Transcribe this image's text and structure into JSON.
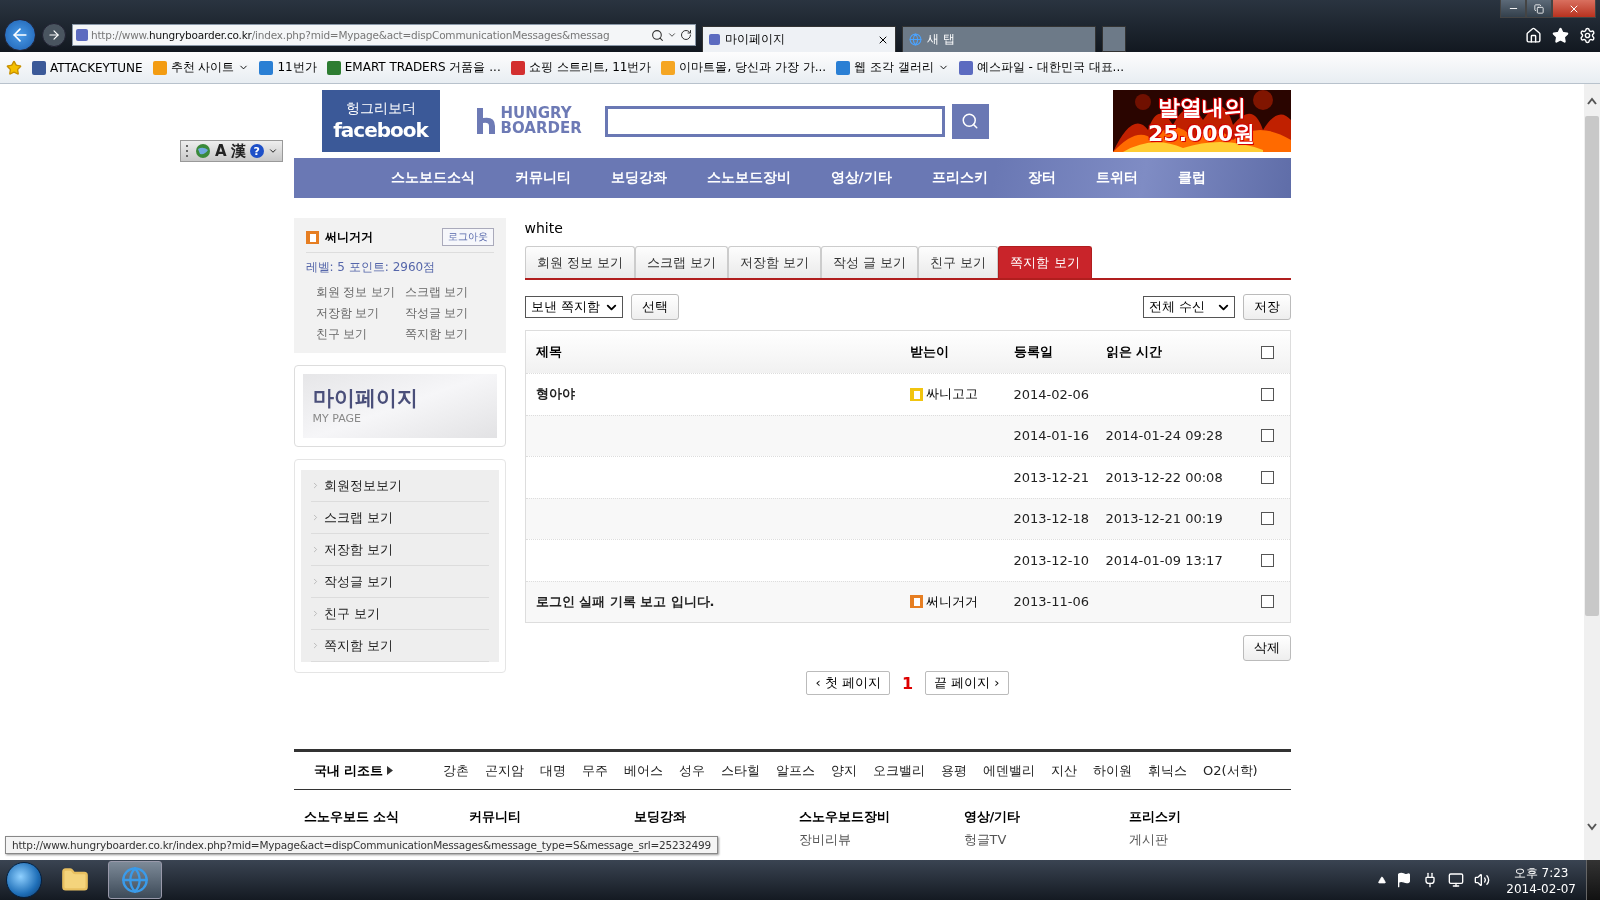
{
  "browser": {
    "address": "http://www.**hungryboarder.co.kr**/index.php?mid=Mypage&act=dispCommunicationMessages&messag",
    "tabs": [
      {
        "title": "마이페이지",
        "selected": true
      },
      {
        "title": "새 탭",
        "selected": false
      }
    ],
    "favorites": [
      {
        "label": "ATTACKEYTUNE",
        "color": "#3b5998",
        "dropdown": false
      },
      {
        "label": "추천 사이트",
        "color": "#f39c12",
        "dropdown": true
      },
      {
        "label": "11번가",
        "color": "#2a7fd4",
        "dropdown": false
      },
      {
        "label": "EMART TRADERS 거품을 ...",
        "color": "#2e7d32",
        "dropdown": false
      },
      {
        "label": "쇼핑 스트리트, 11번가",
        "color": "#d32f2f",
        "dropdown": false
      },
      {
        "label": "이마트몰, 당신과 가장 가...",
        "color": "#f5a623",
        "dropdown": false
      },
      {
        "label": "웹 조각 갤러리",
        "color": "#2a7fd4",
        "dropdown": true
      },
      {
        "label": "예스파일 - 대한민국 대표...",
        "color": "#5c6bc0",
        "dropdown": false
      }
    ]
  },
  "language_bar": {
    "items": [
      "A",
      "漢"
    ],
    "help": "?"
  },
  "header": {
    "facebook_logo": {
      "line1": "헝그리보더",
      "line2": "facebook"
    },
    "logo": {
      "line1": "HUNGRY",
      "line2": "BOARDER"
    },
    "banner": {
      "line1": "발열내의",
      "line2": "25.000원"
    }
  },
  "nav": [
    "스노보드소식",
    "커뮤니티",
    "보딩강좌",
    "스노보드장비",
    "영상/기타",
    "프리스키",
    "장터",
    "트위터",
    "클럽"
  ],
  "sidebar": {
    "user": {
      "name": "써니거거",
      "color": "#e67e22",
      "logout": "로그아웃",
      "level": "레벨: 5  포인트: 2960점",
      "links": [
        "회원 정보 보기",
        "스크랩 보기",
        "저장함 보기",
        "작성글 보기",
        "친구 보기",
        "쪽지함 보기"
      ]
    },
    "mypage_banner": {
      "title": "마이페이지",
      "subtitle": "MY PAGE"
    },
    "menu": [
      "회원정보보기",
      "스크랩 보기",
      "저장함 보기",
      "작성글 보기",
      "친구 보기",
      "쪽지함 보기"
    ]
  },
  "main": {
    "username": "white",
    "tabs": [
      {
        "label": "회원 정보 보기",
        "selected": false
      },
      {
        "label": "스크랩 보기",
        "selected": false
      },
      {
        "label": "저장함 보기",
        "selected": false
      },
      {
        "label": "작성 글 보기",
        "selected": false
      },
      {
        "label": "친구 보기",
        "selected": false
      },
      {
        "label": "쪽지함 보기",
        "selected": true
      }
    ],
    "folder_select": "보낸 쪽지함",
    "select_button": "선택",
    "filter_select": "전체 수신",
    "save_button": "저장",
    "table": {
      "columns": [
        "제목",
        "받는이",
        "등록일",
        "읽은 시간"
      ],
      "all_checked": false,
      "rows": [
        {
          "title": "형아야",
          "receiver": {
            "name": "싸니고고",
            "color": "#f1c40f"
          },
          "date": "2014-02-06",
          "checked": false
        },
        {
          "date": "2014-01-16",
          "read_time": "2014-01-24 09:28",
          "checked": false
        },
        {
          "date": "2013-12-21",
          "read_time": "2013-12-22 00:08",
          "checked": false
        },
        {
          "date": "2013-12-18",
          "read_time": "2013-12-21 00:19",
          "checked": false
        },
        {
          "date": "2013-12-10",
          "read_time": "2014-01-09 13:17",
          "checked": false
        },
        {
          "title": "로그인 실패 기록 보고 입니다.",
          "receiver": {
            "name": "써니거거",
            "color": "#e67e22"
          },
          "date": "2013-11-06",
          "checked": false
        }
      ]
    },
    "delete_button": "삭제",
    "pagination": {
      "first": "‹ 첫 페이지",
      "pages": [
        {
          "label": "1",
          "selected": true
        }
      ],
      "last": "끝 페이지 ›"
    }
  },
  "footer": {
    "resort_label": "국내 리조트",
    "resorts": [
      "강촌",
      "곤지암",
      "대명",
      "무주",
      "베어스",
      "성우",
      "스타힐",
      "알프스",
      "양지",
      "오크밸리",
      "용평",
      "에덴밸리",
      "지산",
      "하이원",
      "휘닉스",
      "O2(서학)"
    ],
    "columns": [
      {
        "heading": "스노우보드 소식"
      },
      {
        "heading": "커뮤니티"
      },
      {
        "heading": "보딩강좌"
      },
      {
        "heading": "스노우보드장비",
        "links": [
          "장비리뷰"
        ]
      },
      {
        "heading": "영상/기타",
        "links": [
          "헝글TV"
        ]
      },
      {
        "heading": "프리스키",
        "links": [
          "게시판"
        ]
      }
    ]
  },
  "status_tooltip": "http://www.hungryboarder.co.kr/index.php?mid=Mypage&act=dispCommunicationMessages&message_type=S&message_srl=25232499",
  "taskbar": {
    "apps": [
      {
        "kind": "folder",
        "selected": false
      },
      {
        "kind": "browser",
        "selected": true
      }
    ],
    "clock": {
      "time": "오후 7:23",
      "date": "2014-02-07"
    }
  }
}
